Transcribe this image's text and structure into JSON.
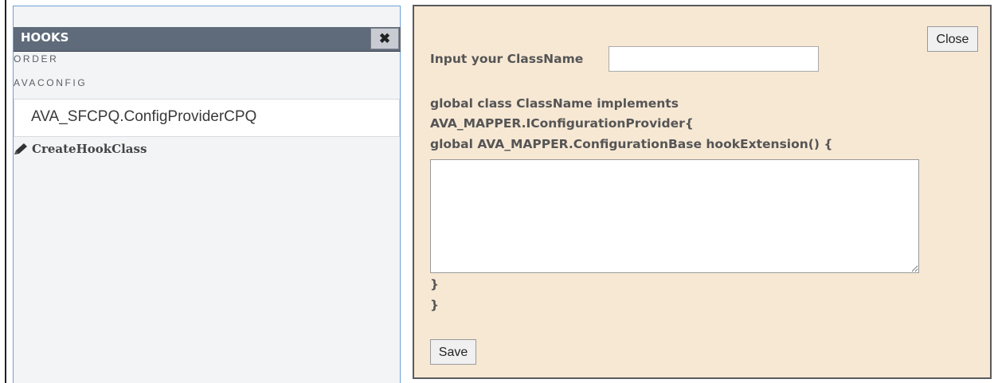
{
  "left_panel": {
    "header_title": "HOOKS",
    "close_glyph": "✖",
    "section_order": "ORDER",
    "section_avaconfig": "AVACONFIG",
    "config_value": "AVA_SFCPQ.ConfigProviderCPQ",
    "create_link_icon": "pencil-icon",
    "create_link_label": "CreateHookClass"
  },
  "right_panel": {
    "close_label": "Close",
    "classname_label": "Input your ClassName",
    "classname_value": "",
    "code_line_1": "global class ClassName implements",
    "code_line_2": "AVA_MAPPER.IConfigurationProvider{",
    "code_line_3": "global AVA_MAPPER.ConfigurationBase hookExtension() {",
    "code_body": "",
    "closing_brace_1": "}",
    "closing_brace_2": "}",
    "save_label": "Save"
  },
  "colors": {
    "left_bg": "#f3f4f6",
    "header_bg": "#5f6a7a",
    "right_bg": "#f7e8d4",
    "left_border": "#6f9fd8"
  }
}
